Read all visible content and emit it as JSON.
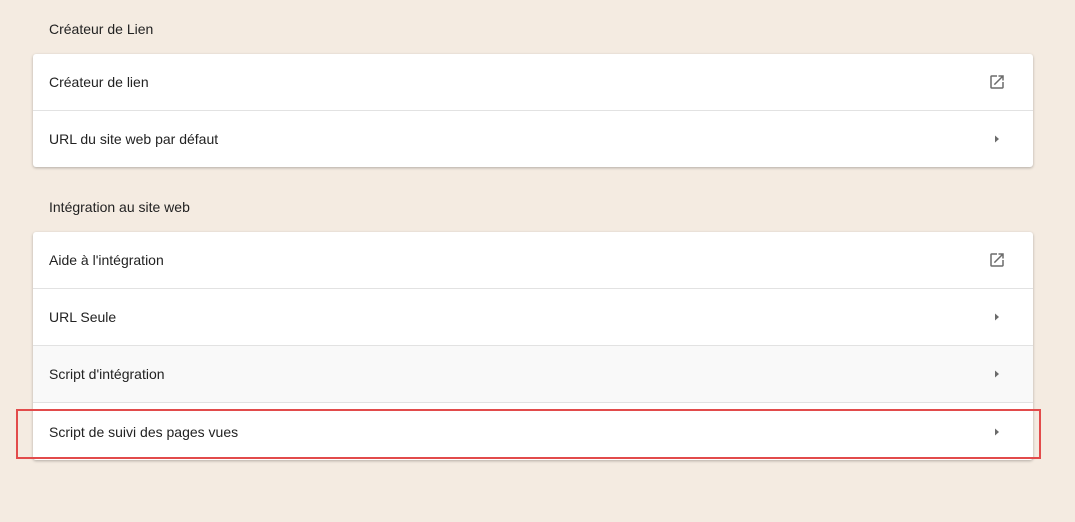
{
  "sections": [
    {
      "title": "Créateur de Lien",
      "items": [
        {
          "label": "Créateur de lien",
          "icon": "open-in-new-icon"
        },
        {
          "label": "URL du site web par défaut",
          "icon": "chevron-right-icon"
        }
      ]
    },
    {
      "title": "Intégration au site web",
      "items": [
        {
          "label": "Aide à l'intégration",
          "icon": "open-in-new-icon"
        },
        {
          "label": "URL Seule",
          "icon": "chevron-right-icon"
        },
        {
          "label": "Script d'intégration",
          "icon": "chevron-right-icon"
        },
        {
          "label": "Script de suivi des pages vues",
          "icon": "chevron-right-icon"
        }
      ]
    }
  ],
  "colors": {
    "background": "#f4ebe1",
    "card": "#ffffff",
    "highlight": "#e24b4b",
    "icon": "#6b6b6b"
  }
}
